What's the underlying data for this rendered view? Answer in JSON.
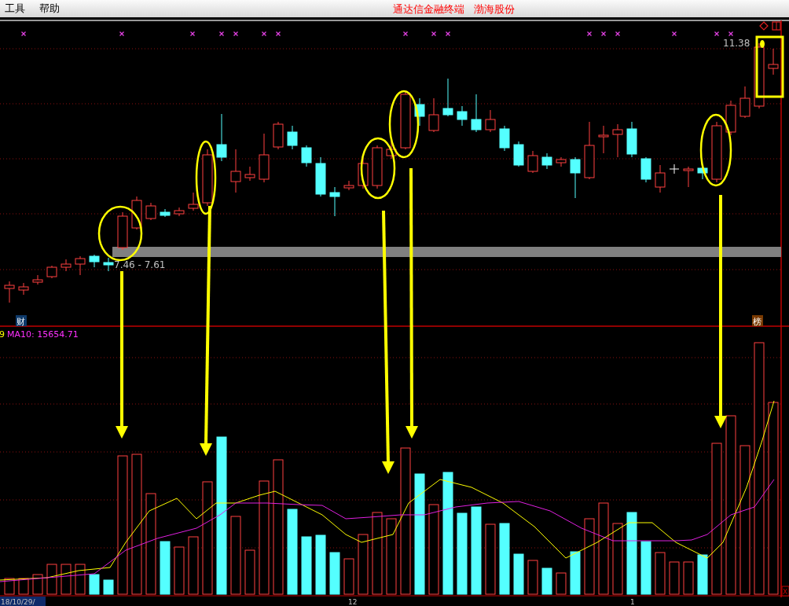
{
  "menu": [
    {
      "label": "工具"
    },
    {
      "label": "帮助"
    }
  ],
  "title": {
    "app": "通达信金融终端",
    "stock": "渤海股份"
  },
  "price_chart": {
    "range_label": "7.46 - 7.61",
    "last_price": "11.38",
    "badge_left": "财",
    "badge_right": "榜"
  },
  "volume_chart": {
    "series_cut": "9",
    "ma10": "MA10: 15654.71"
  },
  "time_axis": {
    "start": "18/10/29/",
    "labels": [
      "12",
      "1"
    ]
  },
  "close_box": "X"
}
